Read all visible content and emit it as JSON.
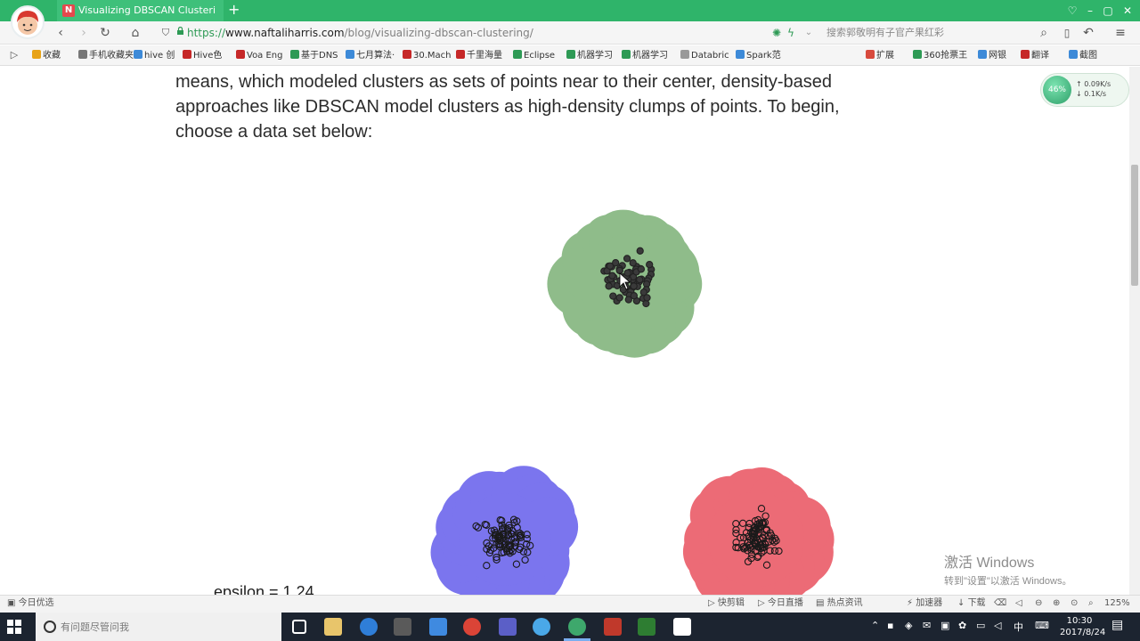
{
  "browser": {
    "tab_title": "Visualizing DBSCAN Clusteri",
    "tab_favicon": "N",
    "new_tab_symbol": "+",
    "url_scheme": "https://",
    "url_host": "www.naftaliharris.com",
    "url_path": "/blog/visualizing-dbscan-clustering/",
    "search_placeholder": "搜索郭敬明有子官产果红彩",
    "icons": [
      "back-icon",
      "forward-icon",
      "reload-icon",
      "home-icon",
      "shield-icon",
      "lock-icon",
      "lightning-icon",
      "search-icon",
      "bookmark-icon",
      "undo-icon",
      "menu-icon"
    ]
  },
  "bookmarks": [
    {
      "label": "收藏",
      "color": "#e8a317"
    },
    {
      "label": "手机收藏夹",
      "color": "#777777"
    },
    {
      "label": "hive 创",
      "color": "#3d8ad8"
    },
    {
      "label": "Hive色",
      "color": "#c62828"
    },
    {
      "label": "Voa Eng",
      "color": "#c62828"
    },
    {
      "label": "基于DNS",
      "color": "#2e9a55"
    },
    {
      "label": "七月算法·",
      "color": "#3d8ad8"
    },
    {
      "label": "30.Mach",
      "color": "#c62828"
    },
    {
      "label": "千里海量",
      "color": "#c62828"
    },
    {
      "label": "Eclipse",
      "color": "#2e9a55"
    },
    {
      "label": "机器学习",
      "color": "#2e9a55"
    },
    {
      "label": "机器学习",
      "color": "#2e9a55"
    },
    {
      "label": "Databric",
      "color": "#999999"
    },
    {
      "label": "Spark范",
      "color": "#3d8ad8"
    },
    {
      "label": "扩展",
      "color": "#d84a3d"
    },
    {
      "label": "360抢票王",
      "color": "#2e9a55"
    },
    {
      "label": "网银",
      "color": "#3d8ad8"
    },
    {
      "label": "翻译",
      "color": "#c62828"
    },
    {
      "label": "截图",
      "color": "#3d8ad8"
    }
  ],
  "article": {
    "paragraph_lines": [
      "means, which modeled clusters as sets of points near to their center, density-based",
      "approaches like DBSCAN model clusters as high-density clumps of points. To begin,",
      "choose a data set below:"
    ],
    "epsilon_label": "epsilon = 1.24"
  },
  "visualization": {
    "clusters": [
      {
        "name": "green-cluster",
        "color": "#8fbc8a",
        "point_style": "filled"
      },
      {
        "name": "blue-cluster",
        "color": "#7b75ee",
        "point_style": "outline"
      },
      {
        "name": "red-cluster",
        "color": "#ec6b76",
        "point_style": "outline"
      }
    ]
  },
  "net_monitor": {
    "percent": "46%",
    "up": "0.09K/s",
    "down": "0.1K/s"
  },
  "activation": {
    "line1": "激活 Windows",
    "line2": "转到\"设置\"以激活 Windows。"
  },
  "statusbar": {
    "left": "今日优选",
    "items": [
      "快剪辑",
      "今日直播",
      "热点资讯",
      "加速器",
      "下载"
    ],
    "zoom": "125%"
  },
  "taskbar": {
    "search_placeholder": "有问题尽管问我",
    "ime": "中",
    "time": "10:30",
    "date": "2017/8/24"
  }
}
